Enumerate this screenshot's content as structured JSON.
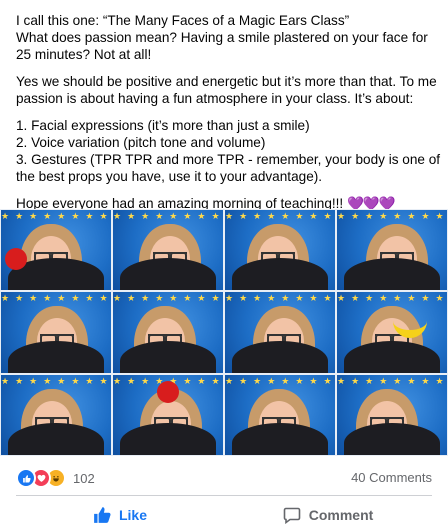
{
  "post": {
    "paragraphs": [
      [
        "I call this one: “The Many Faces of a Magic Ears Class”",
        "What does passion mean? Having a smile plastered on your face for 25 minutes? Not at all!"
      ],
      [
        "Yes we should be positive and energetic but it’s more than that. To me passion is about having a fun atmosphere in your class. It’s about:"
      ],
      [
        "1. Facial expressions (it’s more than just a smile)",
        "2. Voice variation (pitch tone and volume)",
        "3. Gestures (TPR TPR and more TPR - remember, your body is one of the best props you have, use it to your advantage)."
      ]
    ],
    "closing": "Hope everyone had an amazing morning of teaching!!!",
    "closing_emoji": "💜💜💜"
  },
  "collage": {
    "stars_text": "★★★★★★★★★★"
  },
  "stats": {
    "reactions": [
      "like",
      "love",
      "haha"
    ],
    "reaction_count": "102",
    "comments": "40 Comments"
  },
  "actions": {
    "like_label": "Like",
    "comment_label": "Comment"
  },
  "colors": {
    "like_blue": "#1877f2",
    "love_red": "#f33e58",
    "haha_yellow": "#f7b125",
    "muted_text": "#65676b"
  }
}
